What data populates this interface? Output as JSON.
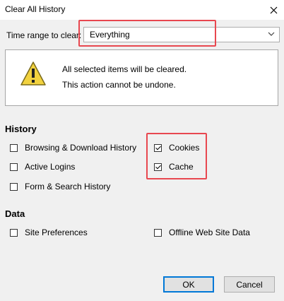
{
  "window": {
    "title": "Clear All History"
  },
  "range": {
    "label": "Time range to clear:",
    "value": "Everything"
  },
  "warning": {
    "line1": "All selected items will be cleared.",
    "line2": "This action cannot be undone."
  },
  "history": {
    "heading": "History",
    "items": [
      {
        "label": "Browsing & Download History",
        "checked": false
      },
      {
        "label": "Active Logins",
        "checked": false
      },
      {
        "label": "Form & Search History",
        "checked": false
      },
      {
        "label": "Cookies",
        "checked": true
      },
      {
        "label": "Cache",
        "checked": true
      }
    ]
  },
  "data_section": {
    "heading": "Data",
    "items": [
      {
        "label": "Site Preferences",
        "checked": false
      },
      {
        "label": "Offline Web Site Data",
        "checked": false
      }
    ]
  },
  "buttons": {
    "ok": "OK",
    "cancel": "Cancel"
  },
  "colors": {
    "highlight": "#e8474f",
    "accent": "#0078d7"
  }
}
